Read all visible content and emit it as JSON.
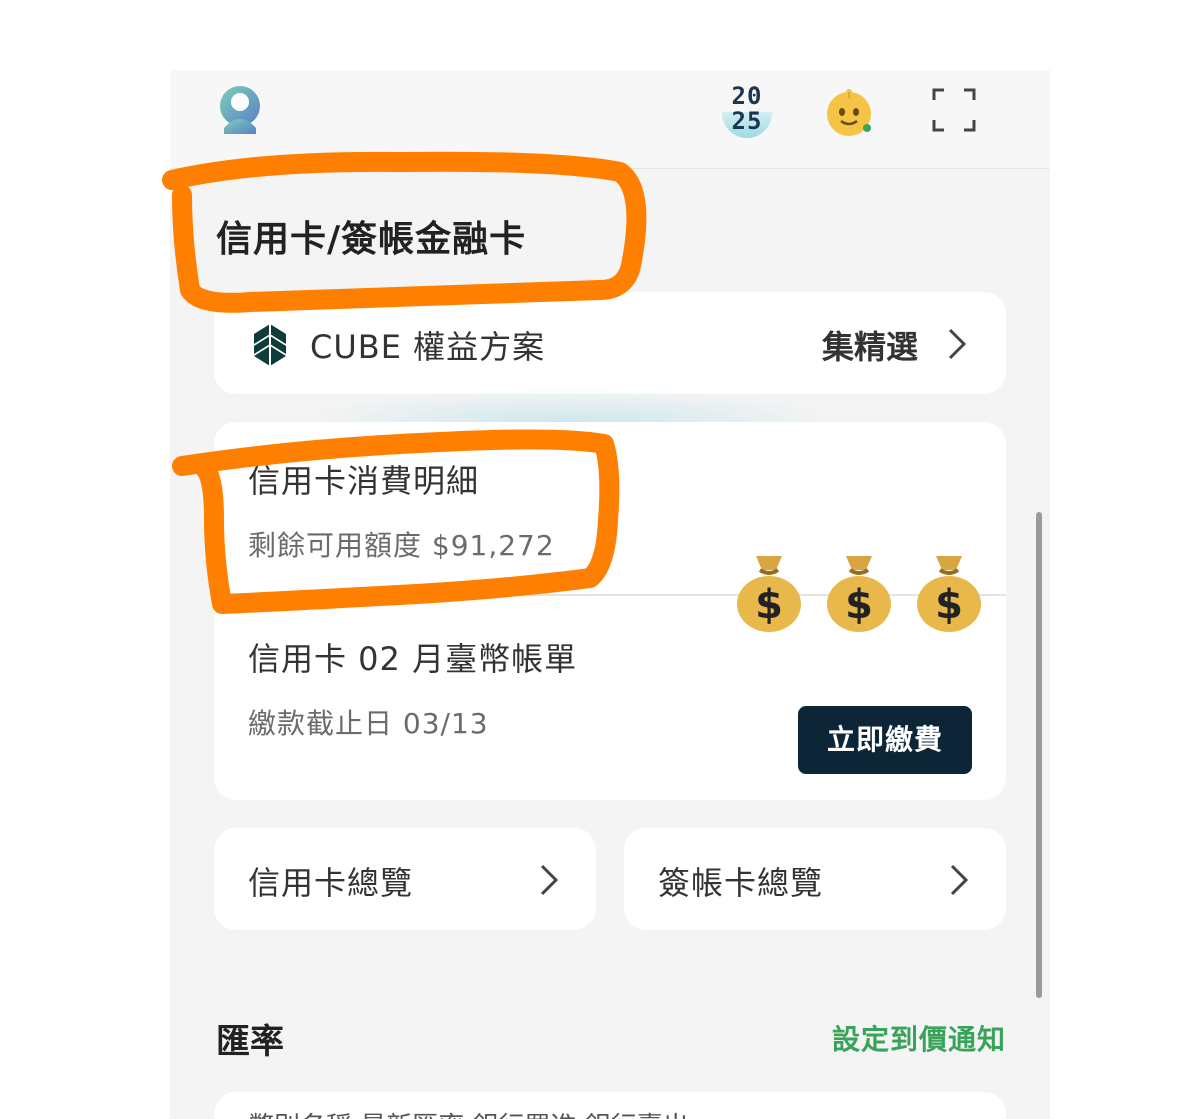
{
  "header": {
    "year_badge_top": "20",
    "year_badge_bottom": "25"
  },
  "section": {
    "title": "信用卡/簽帳金融卡"
  },
  "cube_card": {
    "label": "CUBE 權益方案",
    "right_label": "集精選"
  },
  "bill_card": {
    "detail_title": "信用卡消費明細",
    "remaining_credit": "剩餘可用額度 $91,272",
    "statement_title": "信用卡 02 月臺幣帳單",
    "due_date": "繳款截止日 03/13",
    "pay_button": "立即繳費"
  },
  "overview": {
    "credit_label": "信用卡總覽",
    "debit_label": "簽帳卡總覽"
  },
  "exchange": {
    "title": "匯率",
    "alert_link": "設定到價通知",
    "table_header": "幣別名稱  最新匯率  銀行買進  銀行賣出"
  },
  "colors": {
    "annotation": "#ff8000",
    "pay_button_bg": "#0d2637",
    "link_green": "#3aa35a"
  },
  "icons": [
    "user-avatar-icon",
    "year-2025-badge-icon",
    "assistant-bot-icon",
    "scan-icon",
    "cube-logo-icon",
    "chevron-right-icon",
    "money-bag-icon"
  ]
}
